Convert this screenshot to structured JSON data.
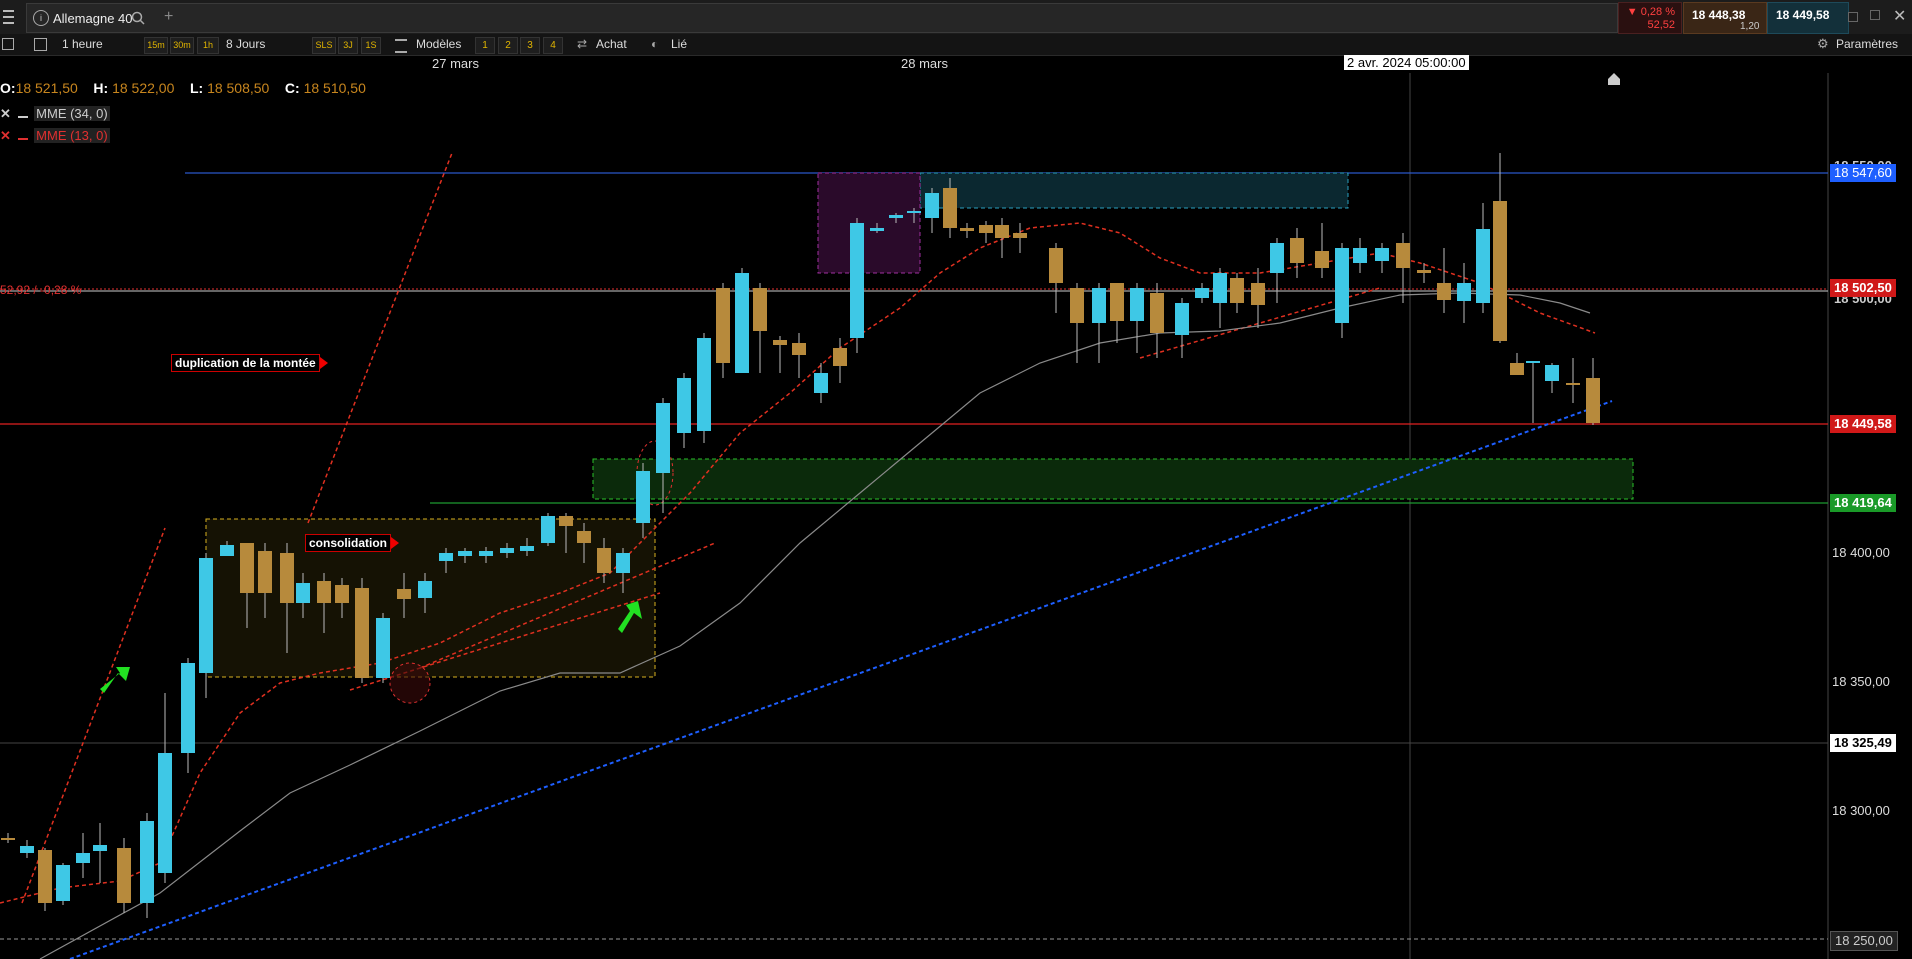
{
  "app": {
    "tab_title": "Allemagne 40",
    "tab_info_icon": "info-icon",
    "add_tab_symbol": "+",
    "change_pct": "▼ 0,28 %",
    "change_pts": "52,52",
    "bid": "18 448,38",
    "ask": "18 449,58",
    "spread": "1,20"
  },
  "toolbar": {
    "timeframe": "1 heure",
    "tf_buttons": [
      "15m",
      "30m",
      "1h"
    ],
    "range": "8 Jours",
    "sls_buttons": [
      "SLS",
      "3J",
      "1S"
    ],
    "models_label": "Modèles",
    "num_buttons": [
      "1",
      "2",
      "3",
      "4"
    ],
    "buy_label": "Achat",
    "link_label": "Lié",
    "settings_label": "Paramètres"
  },
  "dates": {
    "d1": "27 mars",
    "d2": "28 mars",
    "cursor": "2 avr. 2024 05:00:00"
  },
  "ohlc": {
    "o_label": "O:",
    "o": "18 521,50",
    "h_label": "H:",
    "h": "18 522,00",
    "l_label": "L:",
    "l": "18 508,50",
    "c_label": "C:",
    "c": "18 510,50"
  },
  "indicators": {
    "ema1": "MME (34, 0)",
    "ema2": "MME (13, 0)",
    "ref_line": "52,92 / -0,28 %"
  },
  "annotations": {
    "dup": "duplication de la montée",
    "cons": "consolidation"
  },
  "price_axis": {
    "ticks": [
      "18 400,00",
      "18 350,00",
      "18 300,00",
      "18 250,00"
    ],
    "top_clipped": "18 550,00",
    "tag_blue": "18 547,60",
    "tag_red": "18 502,50",
    "tag_grey_hidden": "18 500,00",
    "tag_last": "18 449,58",
    "tag_green": "18 419,64",
    "tag_cursor": "18 325,49"
  },
  "colors": {
    "up": "#3ec8e6",
    "down": "#b78a3c",
    "ema34": "#8a8a8a",
    "ema13": "#e03020",
    "trend": "#1e5fff"
  }
}
